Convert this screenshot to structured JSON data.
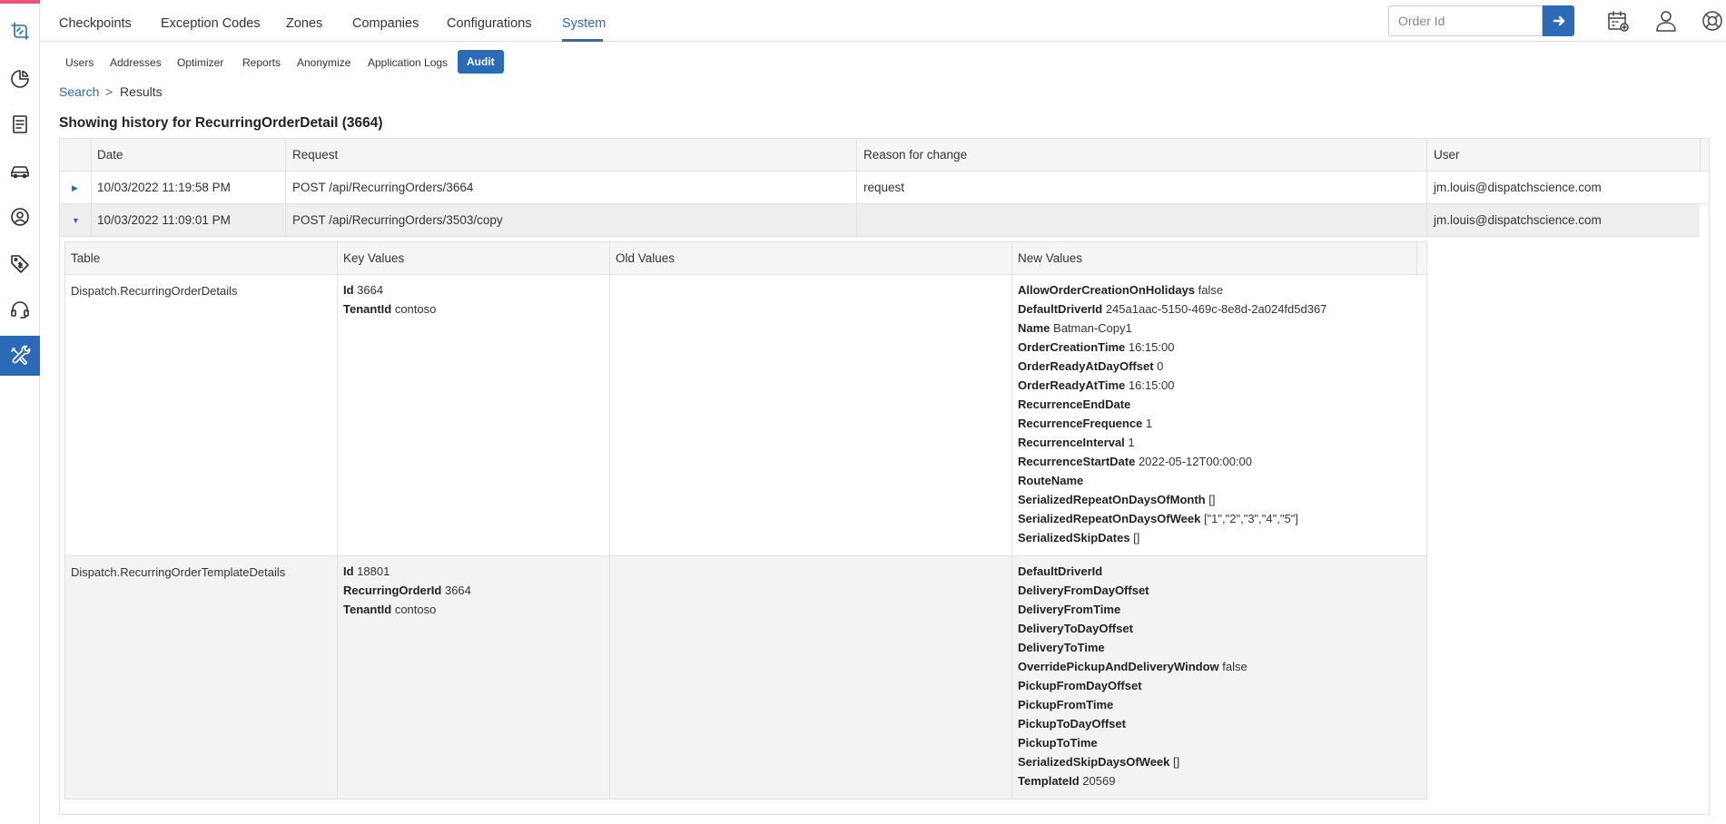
{
  "top_tabs": [
    "Checkpoints",
    "Exception Codes",
    "Zones",
    "Companies",
    "Configurations",
    "System"
  ],
  "active_top_tab": "System",
  "sub_tabs": [
    "Users",
    "Addresses",
    "Optimizer",
    "Reports",
    "Anonymize",
    "Application Logs",
    "Audit"
  ],
  "active_sub_tab": "Audit",
  "order_search": {
    "placeholder": "Order Id"
  },
  "breadcrumb": {
    "search": "Search",
    "sep": ">",
    "current": "Results"
  },
  "heading": "Showing history for RecurringOrderDetail (3664)",
  "history_table": {
    "headers": [
      "Date",
      "Request",
      "Reason for change",
      "User"
    ],
    "rows": [
      {
        "date": "10/03/2022 11:19:58 PM",
        "request": "POST /api/RecurringOrders/3664",
        "reason": "request",
        "user": "jm.louis@dispatchscience.com",
        "expanded": false
      },
      {
        "date": "10/03/2022 11:09:01 PM",
        "request": "POST /api/RecurringOrders/3503/copy",
        "reason": "",
        "user": "jm.louis@dispatchscience.com",
        "expanded": true
      }
    ]
  },
  "detail_table": {
    "headers": [
      "Table",
      "Key Values",
      "Old Values",
      "New Values"
    ],
    "rows": [
      {
        "table": "Dispatch.RecurringOrderDetails",
        "key_values": [
          {
            "k": "Id",
            "v": "3664"
          },
          {
            "k": "TenantId",
            "v": "contoso"
          }
        ],
        "new_values": [
          {
            "k": "AllowOrderCreationOnHolidays",
            "v": "false"
          },
          {
            "k": "DefaultDriverId",
            "v": "245a1aac-5150-469c-8e8d-2a024fd5d367"
          },
          {
            "k": "Name",
            "v": "Batman-Copy1"
          },
          {
            "k": "OrderCreationTime",
            "v": "16:15:00"
          },
          {
            "k": "OrderReadyAtDayOffset",
            "v": "0"
          },
          {
            "k": "OrderReadyAtTime",
            "v": "16:15:00"
          },
          {
            "k": "RecurrenceEndDate",
            "v": ""
          },
          {
            "k": "RecurrenceFrequence",
            "v": "1"
          },
          {
            "k": "RecurrenceInterval",
            "v": "1"
          },
          {
            "k": "RecurrenceStartDate",
            "v": "2022-05-12T00:00:00"
          },
          {
            "k": "RouteName",
            "v": ""
          },
          {
            "k": "SerializedRepeatOnDaysOfMonth",
            "v": "[]"
          },
          {
            "k": "SerializedRepeatOnDaysOfWeek",
            "v": "[\"1\",\"2\",\"3\",\"4\",\"5\"]"
          },
          {
            "k": "SerializedSkipDates",
            "v": "[]"
          }
        ]
      },
      {
        "table": "Dispatch.RecurringOrderTemplateDetails",
        "key_values": [
          {
            "k": "Id",
            "v": "18801"
          },
          {
            "k": "RecurringOrderId",
            "v": "3664"
          },
          {
            "k": "TenantId",
            "v": "contoso"
          }
        ],
        "new_values": [
          {
            "k": "DefaultDriverId",
            "v": ""
          },
          {
            "k": "DeliveryFromDayOffset",
            "v": ""
          },
          {
            "k": "DeliveryFromTime",
            "v": ""
          },
          {
            "k": "DeliveryToDayOffset",
            "v": ""
          },
          {
            "k": "DeliveryToTime",
            "v": ""
          },
          {
            "k": "OverridePickupAndDeliveryWindow",
            "v": "false"
          },
          {
            "k": "PickupFromDayOffset",
            "v": ""
          },
          {
            "k": "PickupFromTime",
            "v": ""
          },
          {
            "k": "PickupToDayOffset",
            "v": ""
          },
          {
            "k": "PickupToTime",
            "v": ""
          },
          {
            "k": "SerializedSkipDaysOfWeek",
            "v": "[]"
          },
          {
            "k": "TemplateId",
            "v": "20569"
          }
        ]
      }
    ]
  },
  "colors": {
    "accent": "#2a6ab7",
    "brand_strip": "#e8577a"
  }
}
